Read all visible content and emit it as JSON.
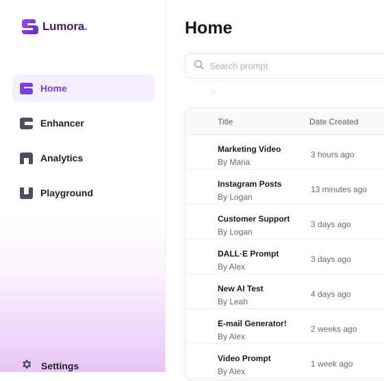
{
  "brand": {
    "name": "Lumora",
    "dot": ".",
    "color": "#7b3fe0"
  },
  "nav": {
    "items": [
      {
        "label": "Home",
        "icon": "home-icon",
        "active": true
      },
      {
        "label": "Enhancer",
        "icon": "enhancer-icon",
        "active": false
      },
      {
        "label": "Analytics",
        "icon": "analytics-icon",
        "active": false
      },
      {
        "label": "Playground",
        "icon": "playground-icon",
        "active": false
      }
    ],
    "settings": {
      "label": "Settings",
      "icon": "gear-icon"
    }
  },
  "main": {
    "title": "Home",
    "search": {
      "placeholder": "Search prompt",
      "value": ""
    },
    "table": {
      "headers": {
        "title": "Title",
        "date": "Date Created"
      },
      "rows": [
        {
          "title": "Marketing Video",
          "author": "By Maria",
          "date": "3 hours ago"
        },
        {
          "title": "Instagram Posts",
          "author": "By Logan",
          "date": "13 minutes ago"
        },
        {
          "title": "Customer Support",
          "author": "By Logan",
          "date": "3 days ago"
        },
        {
          "title": "DALL·E Prompt",
          "author": "By Alex",
          "date": "3 days ago"
        },
        {
          "title": "New AI Test",
          "author": "By Leah",
          "date": "4 days ago"
        },
        {
          "title": "E-mail Generator!",
          "author": "By Alex",
          "date": "2 weeks ago"
        },
        {
          "title": "Video Prompt",
          "author": "By Alex",
          "date": "1 week ago"
        }
      ]
    }
  },
  "colors": {
    "accent": "#7b3fe0",
    "icon_gray": "#4a4f5c",
    "active_bg": "#f4eefd"
  }
}
